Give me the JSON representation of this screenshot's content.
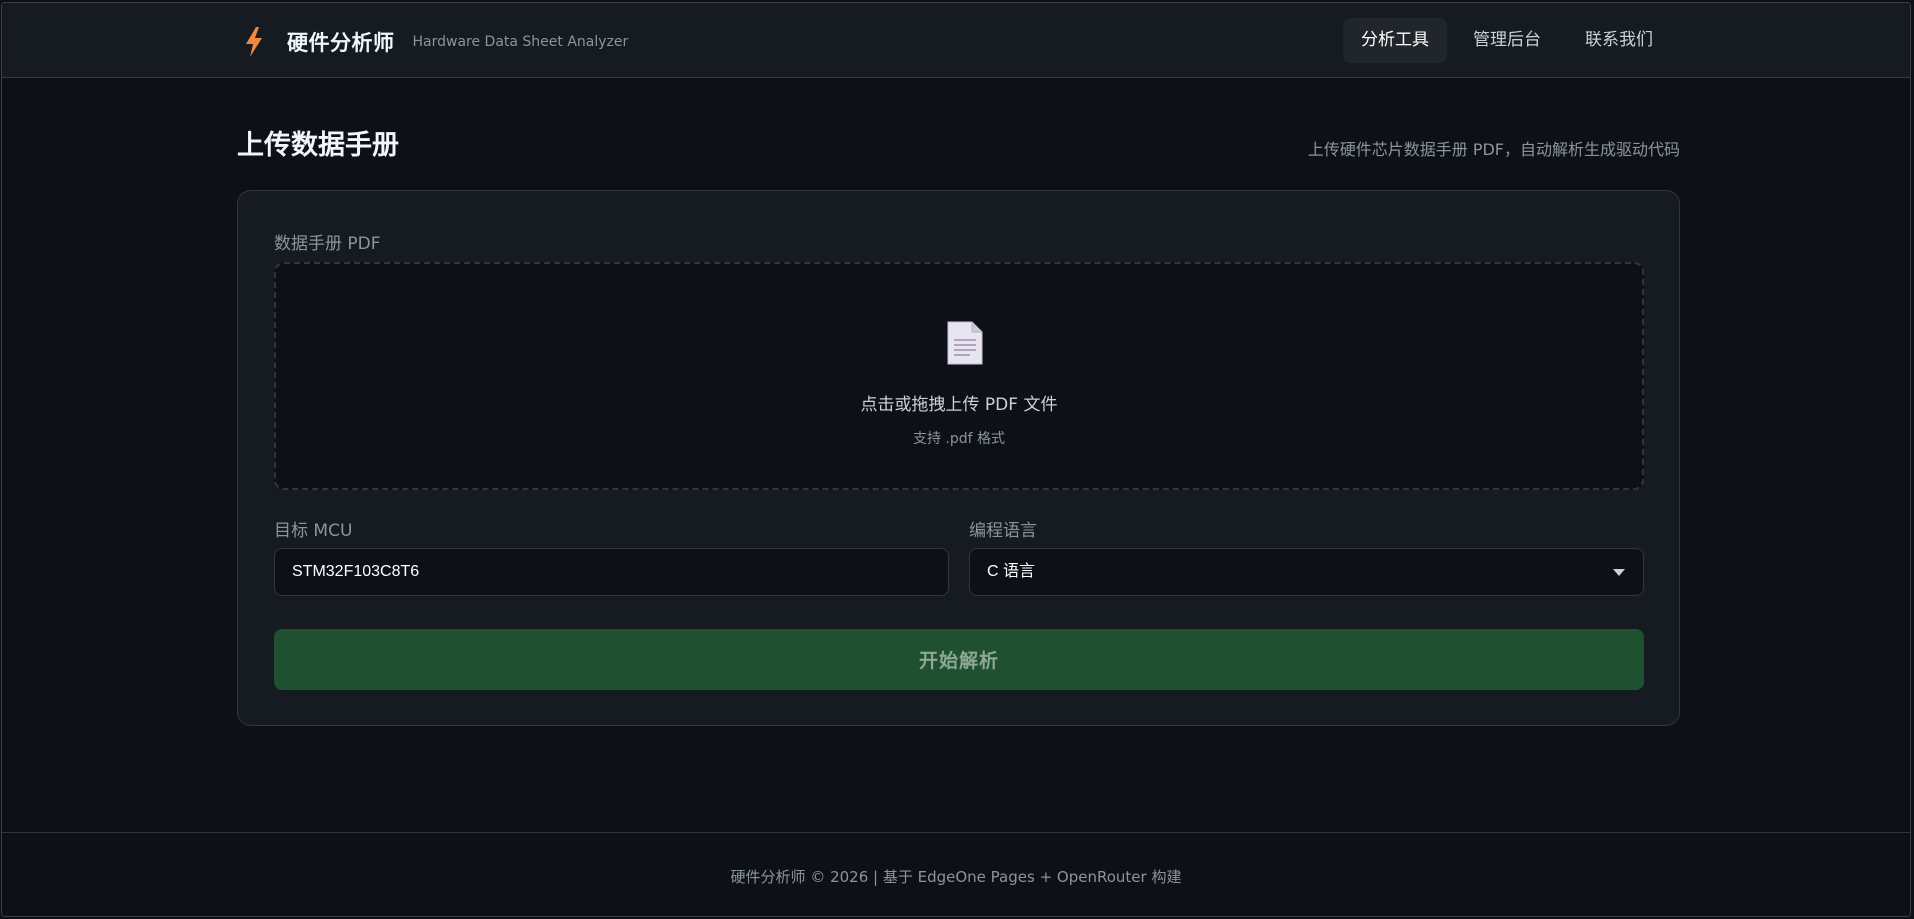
{
  "header": {
    "icon": "lightning-bolt-icon",
    "title": "硬件分析师",
    "subtitle": "Hardware Data Sheet Analyzer",
    "nav": [
      {
        "label": "分析工具",
        "active": true
      },
      {
        "label": "管理后台",
        "active": false
      },
      {
        "label": "联系我们",
        "active": false
      }
    ]
  },
  "page": {
    "title": "上传数据手册",
    "description": "上传硬件芯片数据手册 PDF，自动解析生成驱动代码"
  },
  "form": {
    "pdf_label": "数据手册 PDF",
    "dropzone": {
      "icon": "document-icon",
      "text": "点击或拖拽上传 PDF 文件",
      "hint": "支持 .pdf 格式"
    },
    "mcu_label": "目标 MCU",
    "mcu_value": "STM32F103C8T6",
    "language_label": "编程语言",
    "language_value": "C 语言",
    "submit_label": "开始解析"
  },
  "footer": {
    "text": "硬件分析师 © 2026 | 基于 EdgeOne Pages + OpenRouter 构建"
  },
  "colors": {
    "background": "#0d1117",
    "surface": "#161b22",
    "border": "#30363d",
    "accent_orange": "#f0883e",
    "button_green": "#1f5130"
  }
}
